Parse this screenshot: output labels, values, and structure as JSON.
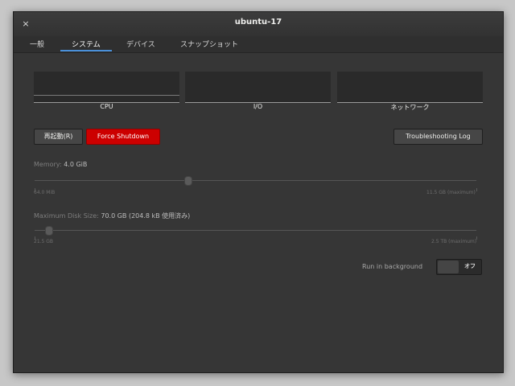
{
  "window": {
    "title": "ubuntu-17",
    "close_glyph": "×"
  },
  "tabs": [
    {
      "label": "一般"
    },
    {
      "label": "システム"
    },
    {
      "label": "デバイス"
    },
    {
      "label": "スナップショット"
    }
  ],
  "active_tab": "システム",
  "graphs": [
    {
      "label": "CPU"
    },
    {
      "label": "I/O"
    },
    {
      "label": "ネットワーク"
    }
  ],
  "buttons": {
    "restart": "再起動(R)",
    "force_shutdown": "Force Shutdown",
    "troubleshooting": "Troubleshooting Log"
  },
  "memory": {
    "label": "Memory:",
    "value": "4.0 GiB",
    "min_label": "64.0 MiB",
    "max_label": "11.5 GB (maximum)"
  },
  "disk": {
    "label": "Maximum Disk Size:",
    "value": "70.0 GB (204.8 kB 使用済み)",
    "min_label": "21.5 GB",
    "max_label": "2.5 TB (maximum)"
  },
  "background": {
    "label": "Run in background",
    "toggle_state": "オフ"
  },
  "colors": {
    "accent_tab": "#4a90d9",
    "danger_button": "#cc0000",
    "window_bg": "#363636"
  }
}
